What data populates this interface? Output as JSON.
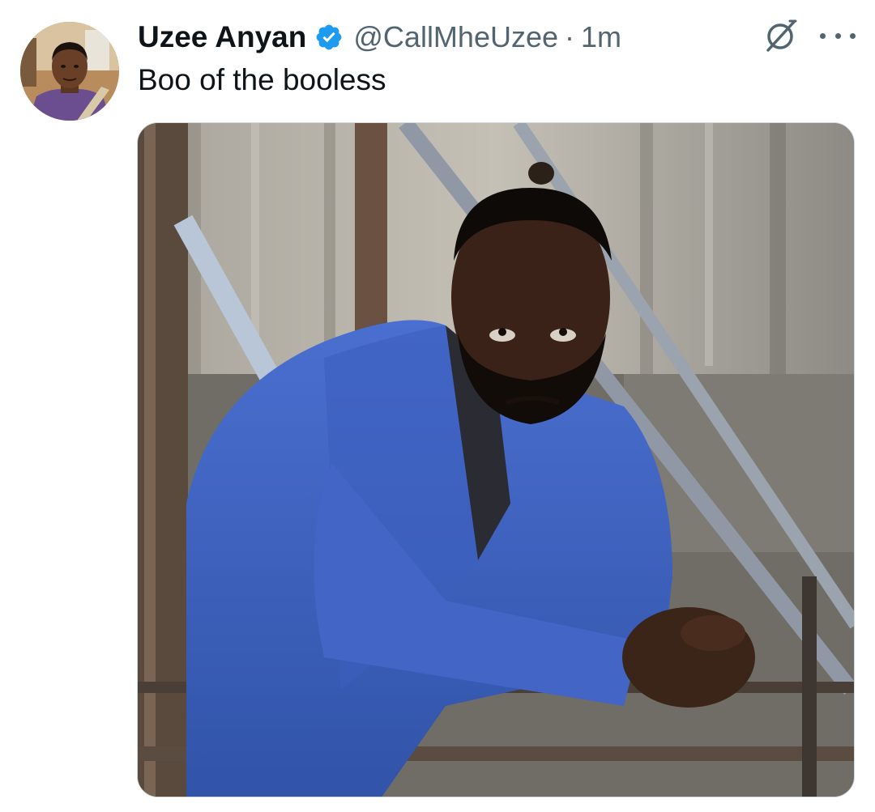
{
  "tweet": {
    "author": {
      "display_name": "Uzee Anyan",
      "handle": "@CallMheUzee",
      "verified": true,
      "avatar_icon": "profile-photo"
    },
    "separator": "·",
    "timestamp": "1m",
    "text": "Boo of the booless",
    "actions": {
      "grok_icon": "grok-icon",
      "more_icon": "more-horizontal-icon"
    },
    "media": {
      "type": "photo",
      "alt": ""
    }
  },
  "colors": {
    "text_primary": "#0f1419",
    "text_secondary": "#536471",
    "verified_blue": "#1d9bf0",
    "border": "#cfd9de"
  }
}
